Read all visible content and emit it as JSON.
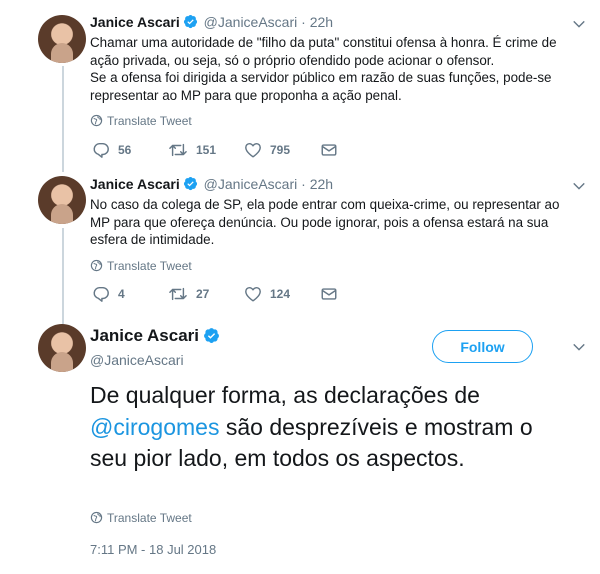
{
  "tweets": [
    {
      "name": "Janice Ascari",
      "handle": "@JaniceAscari",
      "separator": "·",
      "time": "22h",
      "lines": [
        "Chamar uma autoridade de \"filho da puta\" constitui ofensa à honra. É crime de",
        "ação privada, ou seja, só o próprio ofendido pode acionar o ofensor.",
        "Se a ofensa foi dirigida a servidor público em razão de suas funções, pode-se",
        "representar ao MP para que proponha a ação penal."
      ],
      "translate": "Translate Tweet",
      "replies": "56",
      "retweets": "151",
      "likes": "795"
    },
    {
      "name": "Janice Ascari",
      "handle": "@JaniceAscari",
      "separator": "·",
      "time": "22h",
      "lines": [
        "No caso da colega de SP, ela pode entrar com queixa-crime, ou representar ao",
        "MP para que  ofereça denúncia. Ou pode ignorar, pois a ofensa estará na sua",
        "esfera de intimidade."
      ],
      "translate": "Translate Tweet",
      "replies": "4",
      "retweets": "27",
      "likes": "124"
    }
  ],
  "main_tweet": {
    "name": "Janice Ascari",
    "handle": "@JaniceAscari",
    "follow_label": "Follow",
    "text_before": "De qualquer forma, as declarações de ",
    "mention": "@cirogomes",
    "text_after": " são desprezíveis e mostram o seu pior lado, em todos os aspectos.",
    "translate": "Translate Tweet",
    "timestamp": "7:11 PM - 18 Jul 2018"
  },
  "icons": {
    "verified": "verified-badge-icon",
    "chevron": "chevron-down-icon",
    "globe": "globe-icon",
    "reply": "reply-icon",
    "retweet": "retweet-icon",
    "like": "heart-icon",
    "dm": "envelope-icon"
  },
  "colors": {
    "accent": "#1da1f2",
    "mention": "#1b95e0",
    "secondary_text": "#657786",
    "thread_line": "#ccd6dd"
  }
}
